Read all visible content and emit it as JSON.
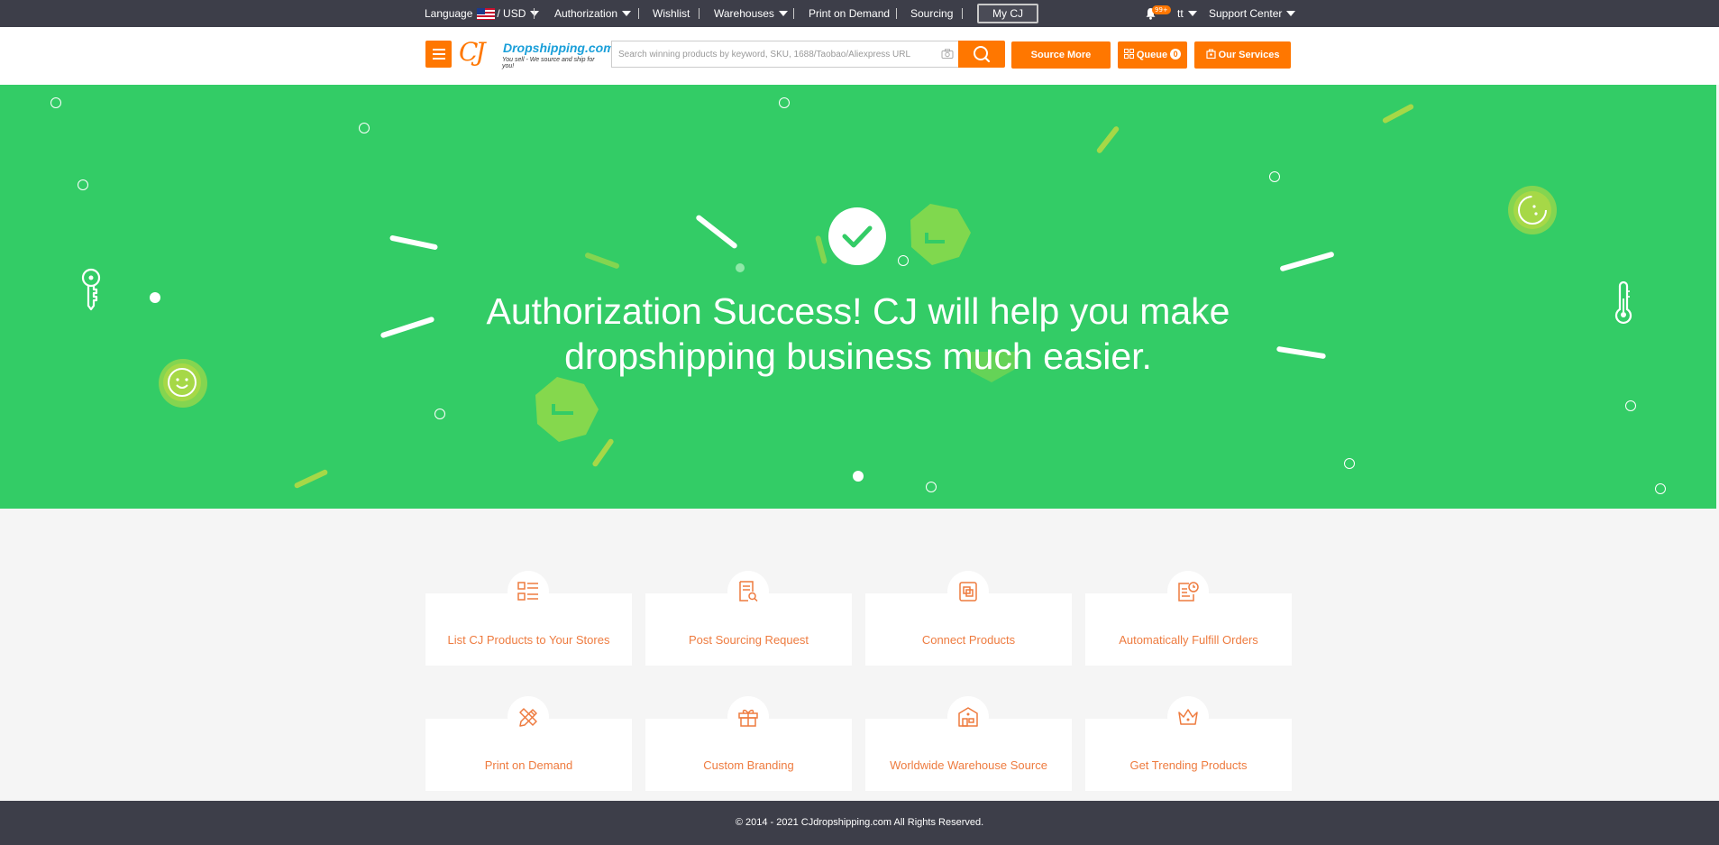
{
  "topbar": {
    "language_label": "Language",
    "currency": "/ USD",
    "authorization": "Authorization",
    "wishlist": "Wishlist",
    "warehouses": "Warehouses",
    "print_on_demand": "Print on Demand",
    "sourcing": "Sourcing",
    "my_cj": "My CJ",
    "notification_badge": "99+",
    "user_short": "tt",
    "support_center": "Support Center"
  },
  "header": {
    "logo_mark": "CJ",
    "logo_name": "Dropshipping.com",
    "logo_slogan": "You sell - We source and ship for you!",
    "search_placeholder": "Search winning products by keyword, SKU, 1688/Taobao/Aliexpress URL",
    "source_more": "Source More",
    "queue": "Queue",
    "queue_count": "0",
    "our_services": "Our Services"
  },
  "banner": {
    "title_line1": "Authorization Success! CJ will help you make",
    "title_line2": "dropshipping business much easier."
  },
  "features": [
    {
      "label": "List CJ Products to Your Stores",
      "icon": "list-icon"
    },
    {
      "label": "Post Sourcing Request",
      "icon": "document-search-icon"
    },
    {
      "label": "Connect Products",
      "icon": "link-document-icon"
    },
    {
      "label": "Automatically Fulfill Orders",
      "icon": "order-clock-icon"
    },
    {
      "label": "Print on Demand",
      "icon": "pencil-ruler-icon"
    },
    {
      "label": "Custom Branding",
      "icon": "gift-icon"
    },
    {
      "label": "Worldwide Warehouse Source",
      "icon": "warehouse-icon"
    },
    {
      "label": "Get Trending Products",
      "icon": "crown-icon"
    }
  ],
  "footer": {
    "copyright": "© 2014 - 2021 CJdropshipping.com All Rights Reserved."
  },
  "colors": {
    "accent": "#ff7700",
    "banner_green": "#33cc66",
    "topbar_bg": "#3d3e49",
    "feature_text": "#ee7b3f"
  }
}
